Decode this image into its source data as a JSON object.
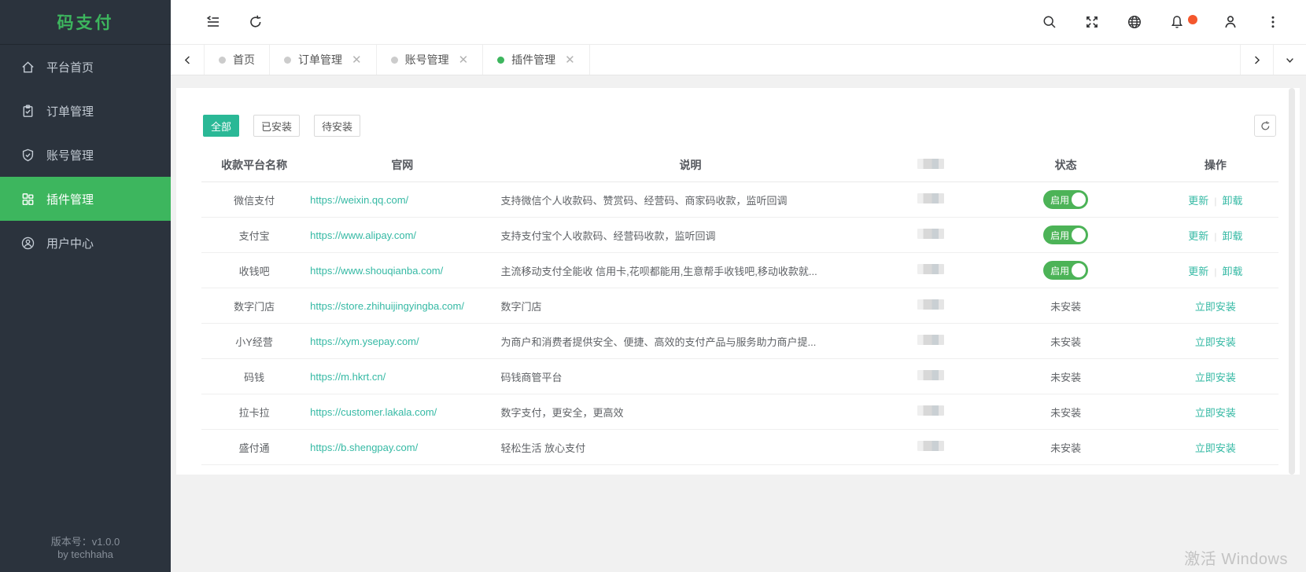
{
  "brand": {
    "logo": "码支付"
  },
  "sidebar": {
    "items": [
      {
        "label": "平台首页",
        "icon": "home-icon",
        "active": false
      },
      {
        "label": "订单管理",
        "icon": "order-icon",
        "active": false
      },
      {
        "label": "账号管理",
        "icon": "shield-icon",
        "active": false
      },
      {
        "label": "插件管理",
        "icon": "plugin-grid-icon",
        "active": true
      },
      {
        "label": "用户中心",
        "icon": "user-icon",
        "active": false
      }
    ],
    "footer": {
      "version": "版本号：v1.0.0",
      "author": "by techhaha"
    }
  },
  "tabbar": {
    "tabs": [
      {
        "label": "首页",
        "closable": false,
        "active": false
      },
      {
        "label": "订单管理",
        "closable": true,
        "active": false
      },
      {
        "label": "账号管理",
        "closable": true,
        "active": false
      },
      {
        "label": "插件管理",
        "closable": true,
        "active": true
      }
    ]
  },
  "filters": {
    "buttons": [
      {
        "label": "全部",
        "active": true
      },
      {
        "label": "已安装",
        "active": false
      },
      {
        "label": "待安装",
        "active": false
      }
    ]
  },
  "table": {
    "headers": {
      "name": "收款平台名称",
      "site": "官网",
      "desc": "说明",
      "redacted": "",
      "status": "状态",
      "action": "操作"
    },
    "labels": {
      "enabled": "启用",
      "not_installed": "未安装",
      "update": "更新",
      "uninstall": "卸载",
      "install": "立即安装"
    },
    "rows": [
      {
        "name": "微信支付",
        "site": "https://weixin.qq.com/",
        "desc": "支持微信个人收款码、赞赏码、经营码、商家码收款，监听回调",
        "installed": true
      },
      {
        "name": "支付宝",
        "site": "https://www.alipay.com/",
        "desc": "支持支付宝个人收款码、经营码收款，监听回调",
        "installed": true
      },
      {
        "name": "收钱吧",
        "site": "https://www.shouqianba.com/",
        "desc": "主流移动支付全能收 信用卡,花呗都能用,生意帮手收钱吧,移动收款就...",
        "installed": true
      },
      {
        "name": "数字门店",
        "site": "https://store.zhihuijingyingba.com/",
        "desc": "数字门店",
        "installed": false
      },
      {
        "name": "小Y经营",
        "site": "https://xym.ysepay.com/",
        "desc": "为商户和消费者提供安全、便捷、高效的支付产品与服务助力商户提...",
        "installed": false
      },
      {
        "name": "码钱",
        "site": "https://m.hkrt.cn/",
        "desc": "码钱商管平台",
        "installed": false
      },
      {
        "name": "拉卡拉",
        "site": "https://customer.lakala.com/",
        "desc": "数字支付，更安全，更高效",
        "installed": false
      },
      {
        "name": "盛付通",
        "site": "https://b.shengpay.com/",
        "desc": "轻松生活 放心支付",
        "installed": false
      }
    ]
  },
  "watermark": "激活 Windows",
  "colors": {
    "accent_green": "#3db65e",
    "accent_teal": "#2ab896",
    "link_teal": "#35b9a4",
    "toggle_green": "#4cb357",
    "notify_dot": "#f4572d",
    "sidebar_bg": "#2b333d"
  }
}
